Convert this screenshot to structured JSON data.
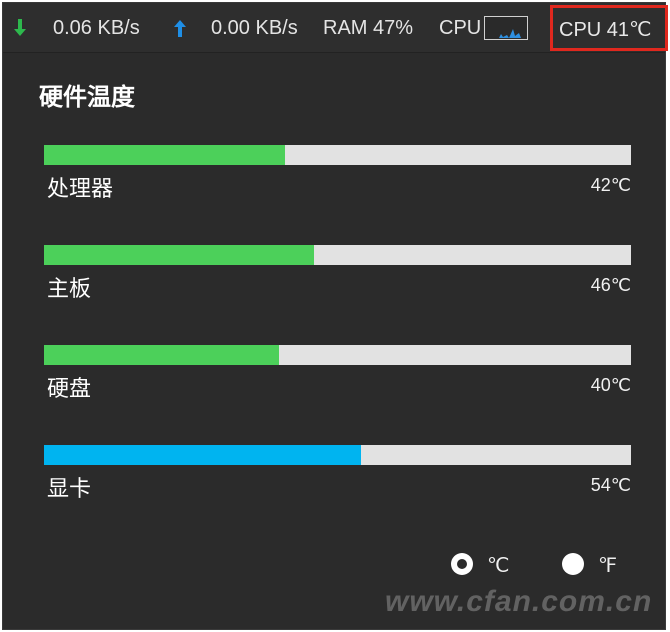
{
  "topbar": {
    "download_speed": "0.06 KB/s",
    "upload_speed": "0.00 KB/s",
    "ram": "RAM 47%",
    "cpu_label": "CPU",
    "cpu_temp": "CPU 41℃",
    "download_icon": "arrow-down-icon",
    "upload_icon": "arrow-up-icon",
    "download_color": "#2db84d",
    "upload_color": "#1f8fe6"
  },
  "panel": {
    "title": "硬件温度",
    "sensors": [
      {
        "label": "处理器",
        "value": "42℃",
        "level": 0.41,
        "color": "#4cd05a"
      },
      {
        "label": "主板",
        "value": "46℃",
        "level": 0.46,
        "color": "#4cd05a"
      },
      {
        "label": "硬盘",
        "value": "40℃",
        "level": 0.4,
        "color": "#4cd05a"
      },
      {
        "label": "显卡",
        "value": "54℃",
        "level": 0.54,
        "color": "#00b4f0"
      }
    ]
  },
  "units": {
    "celsius_label": "℃",
    "fahrenheit_label": "℉",
    "selected": "celsius"
  },
  "watermark": "www.cfan.com.cn"
}
